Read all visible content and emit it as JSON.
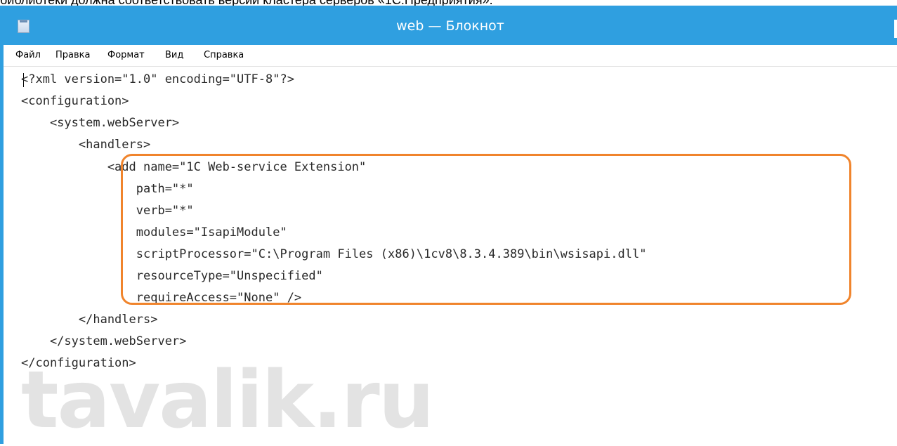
{
  "caption": "библиотеки должна соответствовать версии кластера серверов «1С:Предприятия».",
  "window": {
    "title": "web — Блокнот",
    "app_icon": "notepad-icon"
  },
  "menu": [
    {
      "label": "Файл"
    },
    {
      "label": "Правка"
    },
    {
      "label": "Формат"
    },
    {
      "label": "Вид"
    },
    {
      "label": "Справка"
    }
  ],
  "editor": {
    "lines": [
      "<?xml version=\"1.0\" encoding=\"UTF-8\"?>",
      "<configuration>",
      "    <system.webServer>",
      "        <handlers>",
      "            <add name=\"1C Web-service Extension\"",
      "                path=\"*\"",
      "                verb=\"*\"",
      "                modules=\"IsapiModule\"",
      "                scriptProcessor=\"C:\\Program Files (x86)\\1cv8\\8.3.4.389\\bin\\wsisapi.dll\"",
      "                resourceType=\"Unspecified\"",
      "                requireAccess=\"None\" />",
      "        </handlers>",
      "    </system.webServer>",
      "</configuration>"
    ]
  },
  "watermark": "tavalik.ru",
  "colors": {
    "titlebar": "#2f9fe0",
    "highlight": "#f0842c",
    "watermark": "#e3e3e3"
  }
}
